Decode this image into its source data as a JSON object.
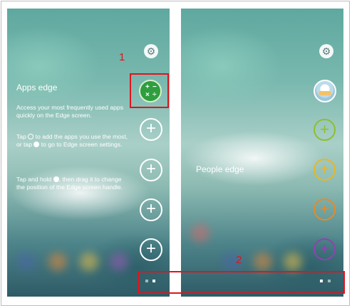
{
  "callouts": {
    "first": "1",
    "second": "2"
  },
  "apps_panel": {
    "title": "Apps edge",
    "paragraph1": "Access your most frequently used apps quickly on the Edge screen.",
    "p2_part1": "Tap",
    "p2_part2": "to add the apps you use the most, or tap",
    "p2_part3": "to go to Edge screen settings.",
    "p3_part1": "Tap and hold",
    "p3_part2": ", then drag it to change the position of the Edge screen handle.",
    "settings_icon": "gear-icon",
    "selected_app_icon": "calculator-icon",
    "add_button_glyph": "+",
    "calc_symbols": [
      "+",
      "−",
      "×",
      "÷"
    ]
  },
  "people_panel": {
    "title": "People edge",
    "settings_icon": "gear-icon",
    "contact_icon": "contact-avatar-icon",
    "add_button_glyph": "+",
    "contact_slot_colors": [
      "#8fbf2e",
      "#e8b625",
      "#e58a2a",
      "#8e44ad"
    ]
  },
  "colors": {
    "highlight": "#e0141e",
    "calculator": "#2e9e3e"
  }
}
